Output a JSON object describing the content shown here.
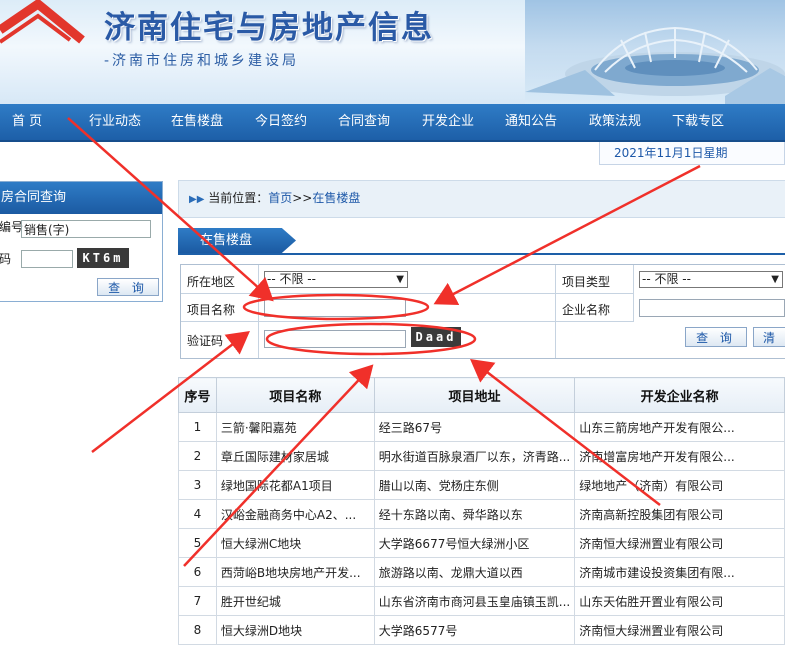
{
  "header": {
    "title": "济南住宅与房地产信息",
    "subtitle": "-济南市住房和城乡建设局"
  },
  "nav": {
    "items": [
      "首 页",
      "行业动态",
      "在售楼盘",
      "今日签约",
      "合同查询",
      "开发企业",
      "通知公告",
      "政策法规",
      "下载专区"
    ]
  },
  "date_text": "2021年11月1日星期",
  "left_panel": {
    "title": "房合同查询",
    "field1_label": "编号",
    "field1_value": "销售(字)",
    "field2_label": "码",
    "captcha": "KT6m",
    "query_button": "查 询"
  },
  "breadcrumb": {
    "prefix": "当前位置：",
    "home": "首页",
    "sep": ">>",
    "current": "在售楼盘"
  },
  "section_tab": "在售楼盘",
  "search_form": {
    "region_label": "所在地区",
    "region_value": "-- 不限 --",
    "type_label": "项目类型",
    "type_value": "-- 不限 --",
    "project_name_label": "项目名称",
    "project_name_value": "",
    "company_label": "企业名称",
    "company_value": "",
    "captcha_label": "验证码",
    "captcha_value": "",
    "captcha_image_text": "Daad",
    "query_button": "查 询",
    "clear_button": "清"
  },
  "table": {
    "headers": [
      "序号",
      "项目名称",
      "项目地址",
      "开发企业名称"
    ],
    "rows": [
      [
        "1",
        "三箭·馨阳嘉苑",
        "经三路67号",
        "山东三箭房地产开发有限公..."
      ],
      [
        "2",
        "章丘国际建材家居城",
        "明水街道百脉泉酒厂以东，济青路...",
        "济南增富房地产开发有限公..."
      ],
      [
        "3",
        "绿地国际花都A1项目",
        "腊山以南、党杨庄东侧",
        "绿地地产（济南）有限公司"
      ],
      [
        "4",
        "汉峪金融商务中心A2、...",
        "经十东路以南、舜华路以东",
        "济南高新控股集团有限公司"
      ],
      [
        "5",
        "恒大绿洲C地块",
        "大学路6677号恒大绿洲小区",
        "济南恒大绿洲置业有限公司"
      ],
      [
        "6",
        "西菏峪B地块房地产开发...",
        "旅游路以南、龙鼎大道以西",
        "济南城市建设投资集团有限..."
      ],
      [
        "7",
        "胜开世纪城",
        "山东省济南市商河县玉皇庙镇玉凯...",
        "山东天佑胜开置业有限公司"
      ],
      [
        "8",
        "恒大绿洲D地块",
        "大学路6577号",
        "济南恒大绿洲置业有限公司"
      ]
    ]
  },
  "annotation_color": "#f0302a"
}
